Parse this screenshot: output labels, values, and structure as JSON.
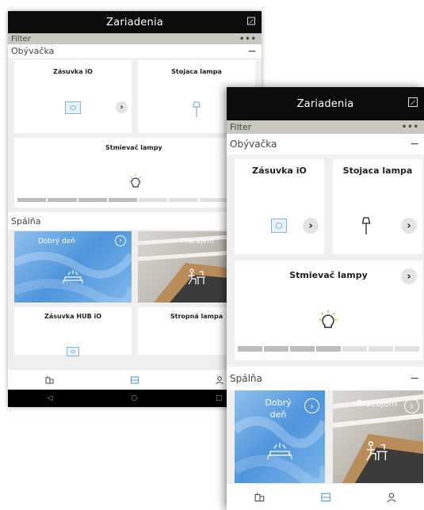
{
  "app": {
    "title": "Zariadenia"
  },
  "filter": {
    "label": "Filter",
    "more": "•••"
  },
  "rooms": {
    "living": {
      "name": "Obývačka",
      "toggle": "−"
    },
    "bedroom": {
      "name": "Spálňa",
      "toggle": "−"
    }
  },
  "devices": {
    "socket": {
      "name": "Zásuvka iO"
    },
    "floor_lamp": {
      "name": "Stojaca lampa"
    },
    "dimmer": {
      "name": "Stmievač lampy",
      "level_percent": 50
    },
    "socket_hub": {
      "name": "Zásuvka HUB iO"
    },
    "ceiling_lamp": {
      "name": "Stropná lampa"
    }
  },
  "scenes": {
    "good_morning": {
      "name": "Dobrý deň"
    },
    "working": {
      "name": "Pracujem"
    }
  },
  "arrow": "›",
  "icons": {
    "edit": "edit-icon",
    "devices": "devices-icon",
    "rooms": "rooms-icon",
    "profile": "profile-icon",
    "back": "◁",
    "home": "○",
    "recent": "□"
  },
  "colors": {
    "accent": "#5b9fe0",
    "appbar": "#0c0c0c",
    "filter": "#c9c7bf"
  }
}
